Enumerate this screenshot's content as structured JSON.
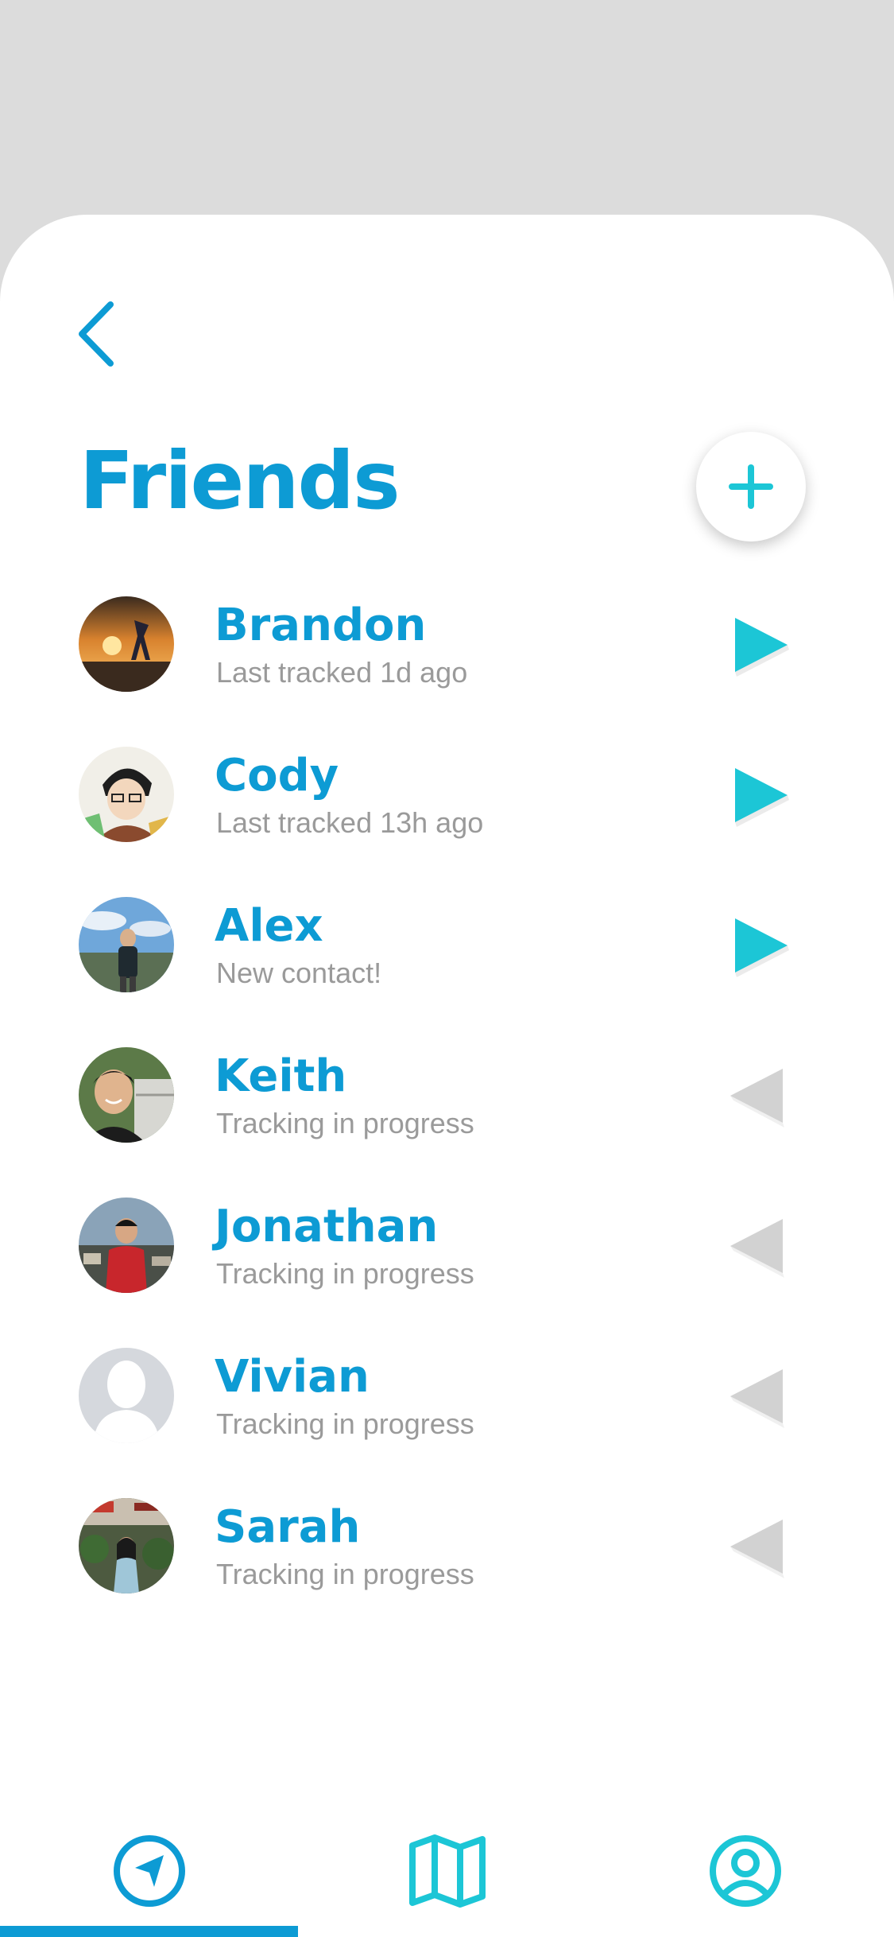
{
  "header": {
    "title": "Friends",
    "back_icon": "chevron-left-icon",
    "add_icon": "plus-icon"
  },
  "colors": {
    "accent_blue": "#0d9bd4",
    "accent_cyan": "#1cc6d6",
    "status_gray": "#9a9a9a",
    "inactive_gray": "#d2d2d2",
    "backdrop": "#dcdcdc"
  },
  "friends": [
    {
      "name": "Brandon",
      "status": "Last tracked 1d ago",
      "action_icon": "play-right-icon",
      "action_state": "active"
    },
    {
      "name": "Cody",
      "status": "Last tracked 13h ago",
      "action_icon": "play-right-icon",
      "action_state": "active"
    },
    {
      "name": "Alex",
      "status": "New contact!",
      "action_icon": "play-right-icon",
      "action_state": "active"
    },
    {
      "name": "Keith",
      "status": "Tracking in progress",
      "action_icon": "play-left-icon",
      "action_state": "inactive"
    },
    {
      "name": "Jonathan",
      "status": "Tracking in progress",
      "action_icon": "play-left-icon",
      "action_state": "inactive"
    },
    {
      "name": "Vivian",
      "status": "Tracking in progress",
      "action_icon": "play-left-icon",
      "action_state": "inactive"
    },
    {
      "name": "Sarah",
      "status": "Tracking in progress",
      "action_icon": "play-left-icon",
      "action_state": "inactive"
    }
  ],
  "tabbar": {
    "tabs": [
      {
        "icon": "navigation-arrow-icon",
        "selected": true
      },
      {
        "icon": "map-icon",
        "selected": false
      },
      {
        "icon": "user-circle-icon",
        "selected": false
      }
    ]
  }
}
